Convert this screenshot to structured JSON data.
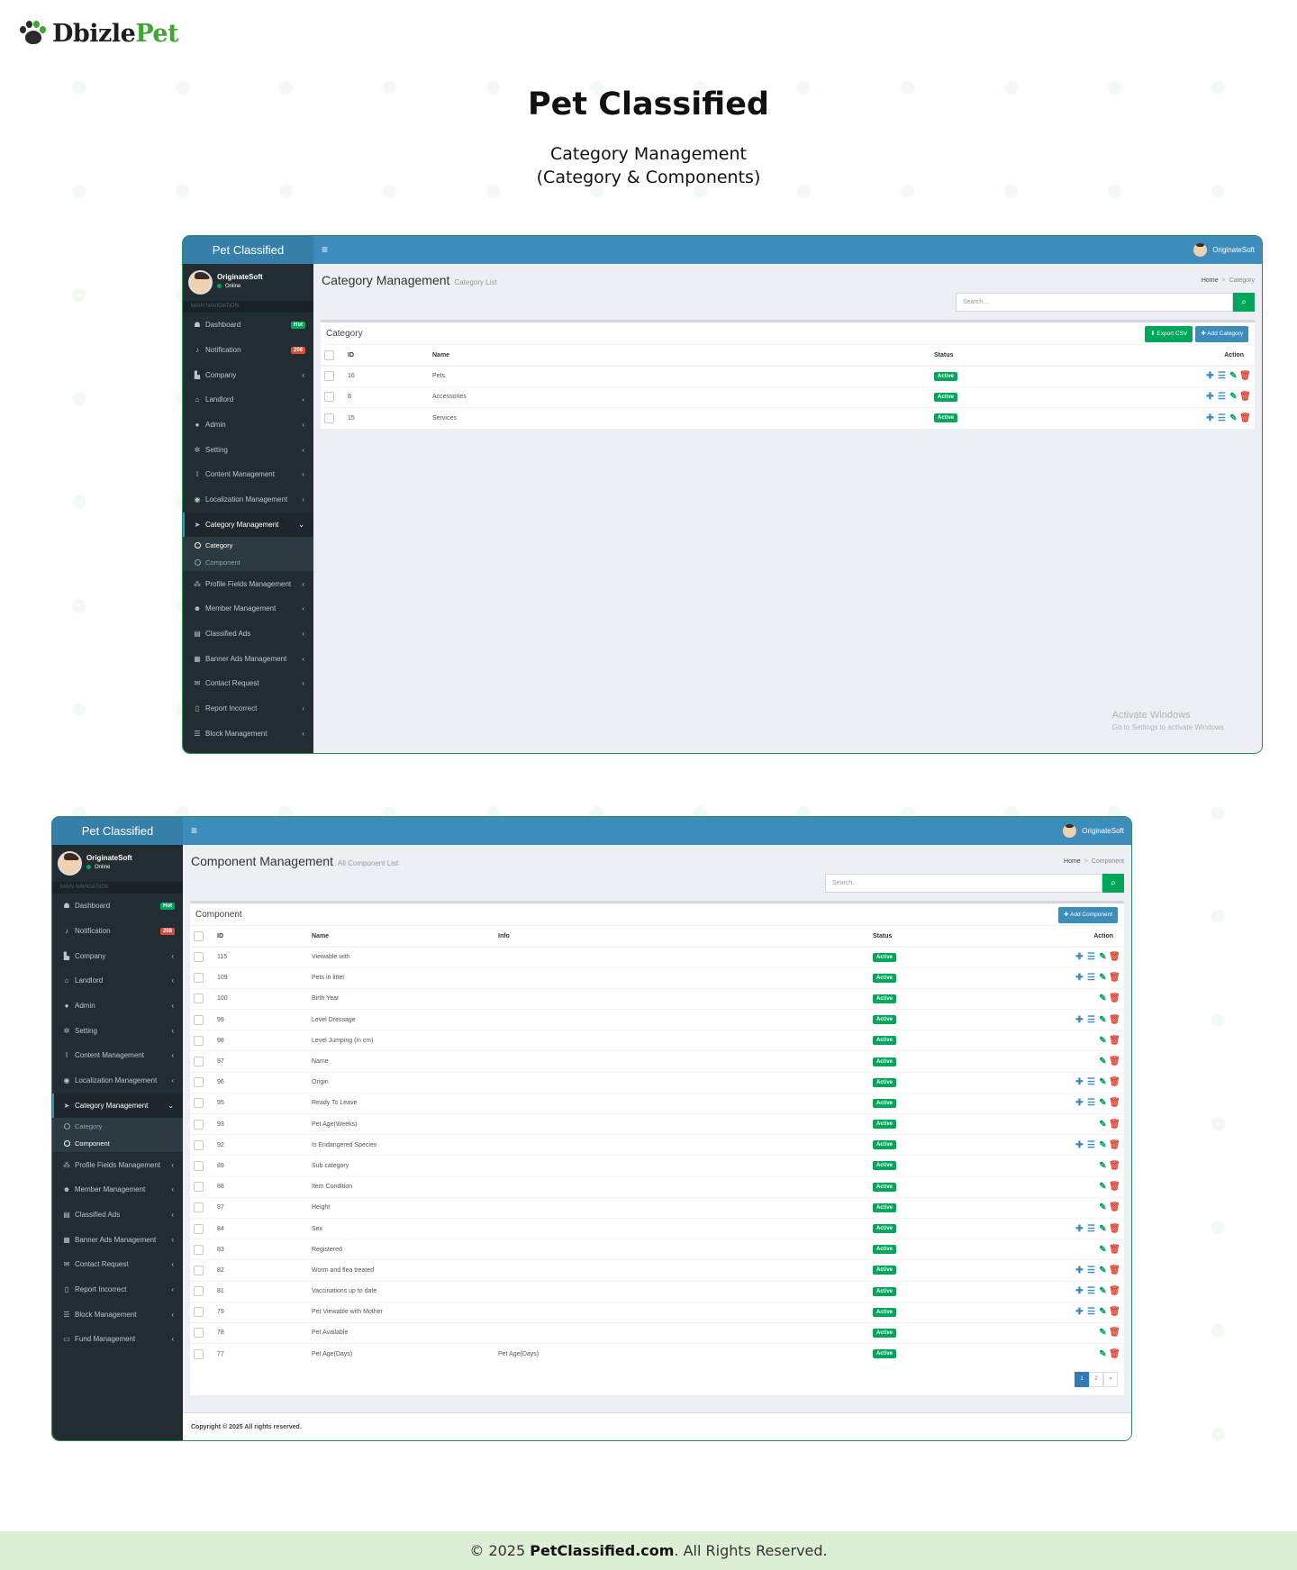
{
  "logo": {
    "part1": "Dbizle",
    "part2": "Pet"
  },
  "hero": {
    "title": "Pet Classified",
    "subtitle_line1": "Category Management",
    "subtitle_line2": "(Category & Components)"
  },
  "app": {
    "brand": "Pet Classified",
    "user_name": "OriginateSoft",
    "user_status": "Online",
    "nav_header": "MAIN NAVIGATION",
    "top_user": "OriginateSoft",
    "hamburger": "≡"
  },
  "nav_items": [
    {
      "label": "Dashboard",
      "icon": "dashboard-icon",
      "glyph": "☗",
      "badge": "Hot",
      "badge_color": "#00a65a"
    },
    {
      "label": "Notification",
      "icon": "bell-icon",
      "glyph": "♪",
      "badge": "208",
      "badge_color": "#dd4b39"
    },
    {
      "label": "Company",
      "icon": "bar-chart-icon",
      "glyph": "▙",
      "caret": "‹"
    },
    {
      "label": "Landlord",
      "icon": "bank-icon",
      "glyph": "⌂",
      "caret": "‹"
    },
    {
      "label": "Admin",
      "icon": "user-icon",
      "glyph": "●",
      "caret": "‹"
    },
    {
      "label": "Setting",
      "icon": "gear-icon",
      "glyph": "✲",
      "caret": "‹"
    },
    {
      "label": "Content Management",
      "icon": "text-cursor-icon",
      "glyph": "I",
      "caret": "‹"
    },
    {
      "label": "Localization Management",
      "icon": "map-marker-icon",
      "glyph": "◉",
      "caret": "‹"
    },
    {
      "label": "Category Management",
      "icon": "pointer-icon",
      "glyph": "➤",
      "caret": "⌄"
    },
    {
      "label": "Profile Fields Management",
      "icon": "cubes-icon",
      "glyph": "⁂",
      "caret": "‹"
    },
    {
      "label": "Member Management",
      "icon": "users-icon",
      "glyph": "☻",
      "caret": "‹"
    },
    {
      "label": "Classified Ads",
      "icon": "briefcase-icon",
      "glyph": "▤",
      "caret": "‹"
    },
    {
      "label": "Banner Ads Management",
      "icon": "calendar-icon",
      "glyph": "▦",
      "caret": "‹"
    },
    {
      "label": "Contact Request",
      "icon": "envelope-icon",
      "glyph": "✉",
      "caret": "‹"
    },
    {
      "label": "Report Incorrect",
      "icon": "file-icon",
      "glyph": "▯",
      "caret": "‹"
    },
    {
      "label": "Block Management",
      "icon": "list-icon",
      "glyph": "☰",
      "caret": "‹"
    },
    {
      "label": "Fund Management",
      "icon": "money-icon",
      "glyph": "▭",
      "caret": "‹"
    }
  ],
  "nav_sub": [
    "Category",
    "Component"
  ],
  "screen1": {
    "page_title": "Category Management",
    "page_subtitle": "Category List",
    "crumb_home": "Home",
    "crumb_sep": ">",
    "crumb_current": "Category",
    "search_placeholder": "Search...",
    "search_btn": "⌕",
    "box_title": "Category",
    "export_btn": "⬇ Export CSV",
    "add_btn": "✚ Add Category",
    "columns": [
      "",
      "ID",
      "Name",
      "Status",
      "Action"
    ],
    "rows": [
      {
        "id": "16",
        "name": "Pets",
        "status": "Active"
      },
      {
        "id": "8",
        "name": "Accessories",
        "status": "Active"
      },
      {
        "id": "15",
        "name": "Services",
        "status": "Active"
      }
    ],
    "activate_title": "Activate Windows",
    "activate_sub": "Go to Settings to activate Windows."
  },
  "screen2": {
    "page_title": "Component Management",
    "page_subtitle": "All Component List",
    "crumb_home": "Home",
    "crumb_sep": ">",
    "crumb_current": "Component",
    "search_placeholder": "Search...",
    "search_btn": "⌕",
    "box_title": "Component",
    "add_btn": "✚ Add Component",
    "columns": [
      "",
      "ID",
      "Name",
      "Info",
      "Status",
      "Action"
    ],
    "rows": [
      {
        "id": "115",
        "name": "Viewable with",
        "info": "",
        "status": "Active",
        "full": true
      },
      {
        "id": "109",
        "name": "Pets in litter",
        "info": "",
        "status": "Active",
        "full": true
      },
      {
        "id": "100",
        "name": "Birth Year",
        "info": "",
        "status": "Active",
        "full": false
      },
      {
        "id": "99",
        "name": "Level Dressage",
        "info": "",
        "status": "Active",
        "full": true
      },
      {
        "id": "98",
        "name": "Level Jumping (in cm)",
        "info": "",
        "status": "Active",
        "full": false
      },
      {
        "id": "97",
        "name": "Name",
        "info": "",
        "status": "Active",
        "full": false
      },
      {
        "id": "96",
        "name": "Origin",
        "info": "",
        "status": "Active",
        "full": true
      },
      {
        "id": "95",
        "name": "Ready To Leave",
        "info": "",
        "status": "Active",
        "full": true
      },
      {
        "id": "93",
        "name": "Pet Age(Weeks)",
        "info": "",
        "status": "Active",
        "full": false
      },
      {
        "id": "92",
        "name": "Is Endangered Species",
        "info": "",
        "status": "Active",
        "full": true
      },
      {
        "id": "89",
        "name": "Sub category",
        "info": "",
        "status": "Active",
        "full": false
      },
      {
        "id": "88",
        "name": "Item Condition",
        "info": "",
        "status": "Active",
        "full": false
      },
      {
        "id": "87",
        "name": "Height",
        "info": "",
        "status": "Active",
        "full": false
      },
      {
        "id": "84",
        "name": "Sex",
        "info": "",
        "status": "Active",
        "full": true
      },
      {
        "id": "83",
        "name": "Registered",
        "info": "",
        "status": "Active",
        "full": false
      },
      {
        "id": "82",
        "name": "Worm and flea treated",
        "info": "",
        "status": "Active",
        "full": true
      },
      {
        "id": "81",
        "name": "Vaccinations up to date",
        "info": "",
        "status": "Active",
        "full": true
      },
      {
        "id": "79",
        "name": "Pet Viewable with Mother",
        "info": "",
        "status": "Active",
        "full": true
      },
      {
        "id": "78",
        "name": "Pet Available",
        "info": "",
        "status": "Active",
        "full": false
      },
      {
        "id": "77",
        "name": "Pet Age(Days)",
        "info": "Pet Age(Days)",
        "status": "Active",
        "full": false
      }
    ],
    "pages": [
      "1",
      "2",
      "»"
    ],
    "copyright": "Copyright © 2025 All rights reserved."
  },
  "icons": {
    "add": "✚",
    "list": "☰",
    "edit": "✎",
    "delete": "🗑"
  },
  "footer": {
    "prefix": "© 2025 ",
    "site": "PetClassified.com",
    "suffix": ". All Rights Reserved."
  },
  "colors": {
    "primary": "#3c8dbc",
    "success": "#00a65a",
    "danger": "#dd4b39",
    "sidebar": "#222d32",
    "brand_green": "#3fa535"
  }
}
